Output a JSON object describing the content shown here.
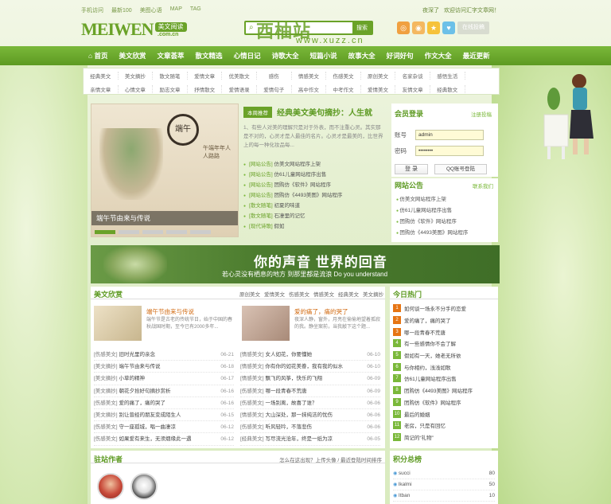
{
  "top_links": [
    "手机访问",
    "最新100",
    "美图心语",
    "MAP",
    "TAG"
  ],
  "top_right": [
    "夜深了",
    "欢迎访问汇字文章网！"
  ],
  "logo": {
    "text": "MEIWEN",
    "badge": "美文阅读",
    "sub": ".com.cn"
  },
  "search": {
    "placeholder": "",
    "button": "搜索"
  },
  "watermark": {
    "title": "西柚站",
    "sub": "www.xuzz.cn"
  },
  "social": {
    "fav_label": "在线投稿"
  },
  "nav": [
    "首页",
    "美文欣赏",
    "文章荟萃",
    "散文精选",
    "心情日记",
    "诗歌大全",
    "短篇小说",
    "故事大全",
    "好词好句",
    "作文大全",
    "最近更新"
  ],
  "subnav_rows": [
    [
      "经典美文",
      "美文摘抄",
      "散文随笔",
      "爱情文章",
      "优美散文",
      "感伤",
      "情感美文",
      "伤感美文",
      "原创美文",
      "名家杂谈",
      "感悟生活"
    ],
    [
      "亲情文章",
      "心情文章",
      "励志文章",
      "抒情散文",
      "爱情语录",
      "爱情句子",
      "高中作文",
      "中考作文",
      "爱情美文",
      "友情文章",
      "经典散文"
    ]
  ],
  "feature": {
    "title": "端午节由来与传说",
    "calligraphy": "端午",
    "verse": "午端年年人人路路"
  },
  "news": {
    "tag": "本周推荐",
    "title": "经典美文美句摘抄：人生就",
    "summary": "1、有些人对美的理解只是对于外表，而不注重心灵。其实那是不对的，心灵才是人最佳的名片。心灵才是最美的，比世界上的每一种化妆品每...",
    "items": [
      {
        "cat": "[网站公告]",
        "text": "仿美文网站程序上架"
      },
      {
        "cat": "[网站公告]",
        "text": "仿61儿童网站程序出售"
      },
      {
        "cat": "[网站公告]",
        "text": "团购仿《软件》网站程序"
      },
      {
        "cat": "[网站公告]",
        "text": "团购仿《4493美图》网站程序"
      },
      {
        "cat": "[散文随笔]",
        "text": "初夏的味道"
      },
      {
        "cat": "[散文随笔]",
        "text": "石凄里的记忆"
      },
      {
        "cat": "[现代诗歌]",
        "text": "假如"
      }
    ]
  },
  "login": {
    "title": "会员登录",
    "link": "注册投稿",
    "user_label": "账号",
    "user_value": "admin",
    "pass_label": "密码",
    "pass_value": "••••••••",
    "login_btn": "登 录",
    "qq_btn": "QQ账号登陆"
  },
  "notice": {
    "title": "网站公告",
    "more": "联系我们",
    "items": [
      "仿美文网站程序上架",
      "仿61儿童网站程序出售",
      "团购仿《软件》网站程序",
      "团购仿《4493美图》网站程序"
    ]
  },
  "banner": {
    "headline": "你的声音 世界的回音",
    "sub": "若心灵没有栖息的地方 到那里都是流浪 Do you understand"
  },
  "meiwen": {
    "title": "美文欣赏",
    "cats": [
      "原创美文",
      "爱情美文",
      "伤感美文",
      "情感美文",
      "经典美文",
      "美文摘抄"
    ],
    "cards": [
      {
        "title": "端午节由来与传说",
        "desc": "端午节是古老的传统节日，始于中国的春秋战国时期，至今已有2000多年..."
      },
      {
        "title": "爱的痛了，痛的哭了",
        "desc": "夜深人静，窗外，月亮在偷偷地望着孤寂的我。静坐案前，当我敲下这个题..."
      }
    ],
    "left_rows": [
      {
        "cat": "[伤感美文]",
        "text": "旧时光里的亲念",
        "date": "06-21"
      },
      {
        "cat": "[美文摘抄]",
        "text": "端午节由来与传说",
        "date": "06-18"
      },
      {
        "cat": "[美文摘抄]",
        "text": "小草的精神",
        "date": "06-17"
      },
      {
        "cat": "[美文摘抄]",
        "text": "朝花夕拾好句摘抄赏析",
        "date": "06-16"
      },
      {
        "cat": "[伤感美文]",
        "text": "爱的痛了，痛的哭了",
        "date": "06-16"
      },
      {
        "cat": "[美文摘抄]",
        "text": "别让曾经的朋友变成陌生人",
        "date": "06-15"
      },
      {
        "cat": "[伤感美文]",
        "text": "守一座孤城，唱一曲凄凉",
        "date": "06-12"
      },
      {
        "cat": "[伤感美文]",
        "text": "如果爱有来生，无须烟缘此一遇",
        "date": "06-12"
      }
    ],
    "right_rows": [
      {
        "cat": "[情感美文]",
        "text": "女人如花，你要懂她",
        "date": "06-10"
      },
      {
        "cat": "[情感美文]",
        "text": "你有你的如花美眷，我有我的似水",
        "date": "06-10"
      },
      {
        "cat": "[情感美文]",
        "text": "飘飞的风筝，快乐的飞翔",
        "date": "06-09"
      },
      {
        "cat": "[伤感美文]",
        "text": "哪一段青春不荒唐",
        "date": "06-09"
      },
      {
        "cat": "[伤感美文]",
        "text": "一场别离，故喜了谁？",
        "date": "06-06"
      },
      {
        "cat": "[情感美文]",
        "text": "大山深处，那一抹纯洁的忧伤",
        "date": "06-06"
      },
      {
        "cat": "[伤感美文]",
        "text": "听风轻吟，不落悲伤",
        "date": "06-06"
      },
      {
        "cat": "[经典美文]",
        "text": "写尽流光沧年，终是一纸为凉",
        "date": "06-05"
      }
    ]
  },
  "hot": {
    "title": "今日热门",
    "items": [
      "如何谈一场永不分手的恋爱",
      "爱的痛了，痛的哭了",
      "哪一段青春不荒唐",
      "有一些感情你不会了解",
      "假如有一天，她老无所依",
      "与你相约，浅浅如歌",
      "仿61儿童网站程序出售",
      "团购仿《4493美图》网站程序",
      "团购仿《软件》网站程序",
      "最后的婚姻",
      "老房，只是有回忆",
      "简记的“礼物”"
    ]
  },
  "authors": {
    "title": "驻站作者",
    "note": "怎么在这出现？上传头像 / 最近登陆时间排序"
  },
  "points": {
    "title": "积分总榜",
    "items": [
      {
        "user": "succi",
        "score": "80"
      },
      {
        "user": "lkalmi",
        "score": "50"
      },
      {
        "user": "Itban",
        "score": "10"
      }
    ]
  },
  "colors": {
    "accent": "#6aa228",
    "nav": "#5d9a22",
    "hot": "#e67514"
  }
}
